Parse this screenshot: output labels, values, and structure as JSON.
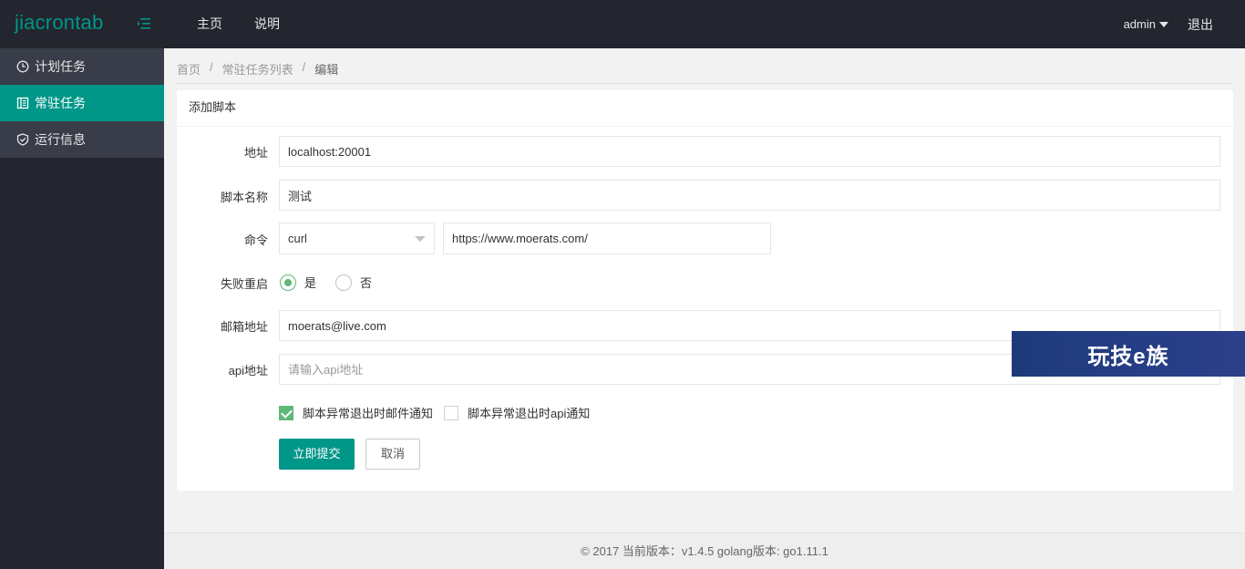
{
  "header": {
    "logo": "jiacrontab",
    "nav": [
      "主页",
      "说明"
    ],
    "user": "admin",
    "logout": "退出",
    "bg_color": "#23262e",
    "accent_color": "#009688"
  },
  "sidebar": {
    "items": [
      {
        "label": "计划任务",
        "icon": "clock-icon",
        "active": false
      },
      {
        "label": "常驻任务",
        "icon": "book-icon",
        "active": true
      },
      {
        "label": "运行信息",
        "icon": "shield-icon",
        "active": false
      }
    ]
  },
  "breadcrumb": [
    "首页",
    "常驻任务列表",
    "编辑"
  ],
  "breadcrumb_sep": "/",
  "form": {
    "title": "添加脚本",
    "address": {
      "label": "地址",
      "value": "localhost:20001"
    },
    "script_name": {
      "label": "脚本名称",
      "value": "测试"
    },
    "command": {
      "label": "命令",
      "select_value": "curl",
      "arg_value": "https://www.moerats.com/"
    },
    "restart": {
      "label": "失败重启",
      "options": [
        "是",
        "否"
      ],
      "selected": "是"
    },
    "email": {
      "label": "邮箱地址",
      "value": "moerats@live.com"
    },
    "api": {
      "label": "api地址",
      "value": "",
      "placeholder": "请输入api地址"
    },
    "notify_email": {
      "label": "脚本异常退出时邮件通知",
      "checked": true
    },
    "notify_api": {
      "label": "脚本异常退出时api通知",
      "checked": false
    },
    "submit": "立即提交",
    "cancel": "取消"
  },
  "watermark": "玩技e族",
  "footer": "© 2017 当前版本：v1.4.5 golang版本: go1.11.1"
}
